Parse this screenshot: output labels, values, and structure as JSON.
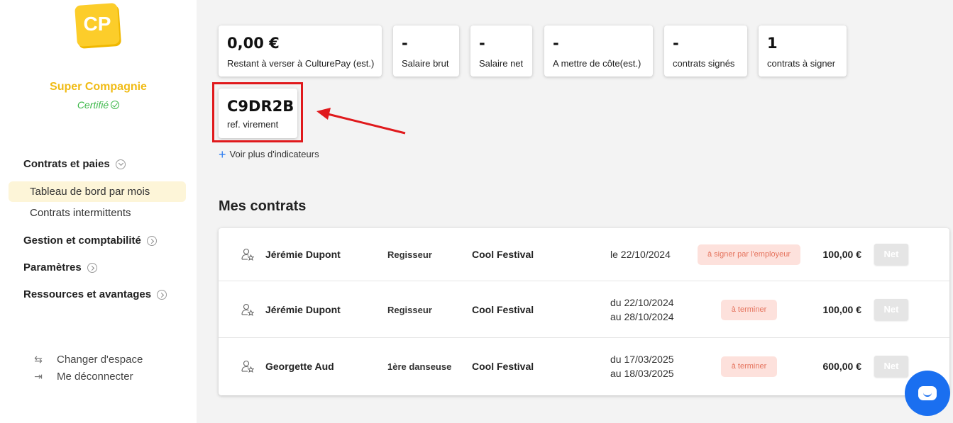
{
  "sidebar": {
    "logo_text": "CP",
    "company": "Super Compagnie",
    "certified": "Certifié",
    "sections": [
      {
        "label": "Contrats et paies",
        "items": [
          "Tableau de bord par mois",
          "Contrats intermittents"
        ]
      },
      {
        "label": "Gestion et comptabilité"
      },
      {
        "label": "Paramètres"
      },
      {
        "label": "Ressources et avantages"
      }
    ],
    "footer": {
      "switch": "Changer d'espace",
      "logout": "Me déconnecter"
    }
  },
  "kpis": [
    {
      "value": "0,00 €",
      "label": "Restant à verser à CulturePay (est.)"
    },
    {
      "value": "-",
      "label": "Salaire brut"
    },
    {
      "value": "-",
      "label": "Salaire net"
    },
    {
      "value": "-",
      "label": "A mettre de côte(est.)"
    },
    {
      "value": "-",
      "label": "contrats signés"
    },
    {
      "value": "1",
      "label": "contrats à signer"
    },
    {
      "value": "C9DR2B",
      "label": "ref. virement"
    }
  ],
  "more_indicators": "Voir plus d'indicateurs",
  "contracts_title": "Mes contrats",
  "contracts": [
    {
      "name": "Jérémie Dupont",
      "role": "Regisseur",
      "event": "Cool Festival",
      "date1": "le 22/10/2024",
      "date2": "",
      "status": "à signer par l'employeur",
      "amount": "100,00 €",
      "action": "Net"
    },
    {
      "name": "Jérémie Dupont",
      "role": "Regisseur",
      "event": "Cool Festival",
      "date1": "du 22/10/2024",
      "date2": "au 28/10/2024",
      "status": "à terminer",
      "amount": "100,00 €",
      "action": "Net"
    },
    {
      "name": "Georgette Aud",
      "role": "1ère danseuse",
      "event": "Cool Festival",
      "date1": "du 17/03/2025",
      "date2": "au 18/03/2025",
      "status": "à terminer",
      "amount": "600,00 €",
      "action": "Net"
    }
  ],
  "colors": {
    "brand": "#fccd2a",
    "certified": "#3db84a",
    "highlight": "#e0191c",
    "chat": "#1a6ff0"
  }
}
